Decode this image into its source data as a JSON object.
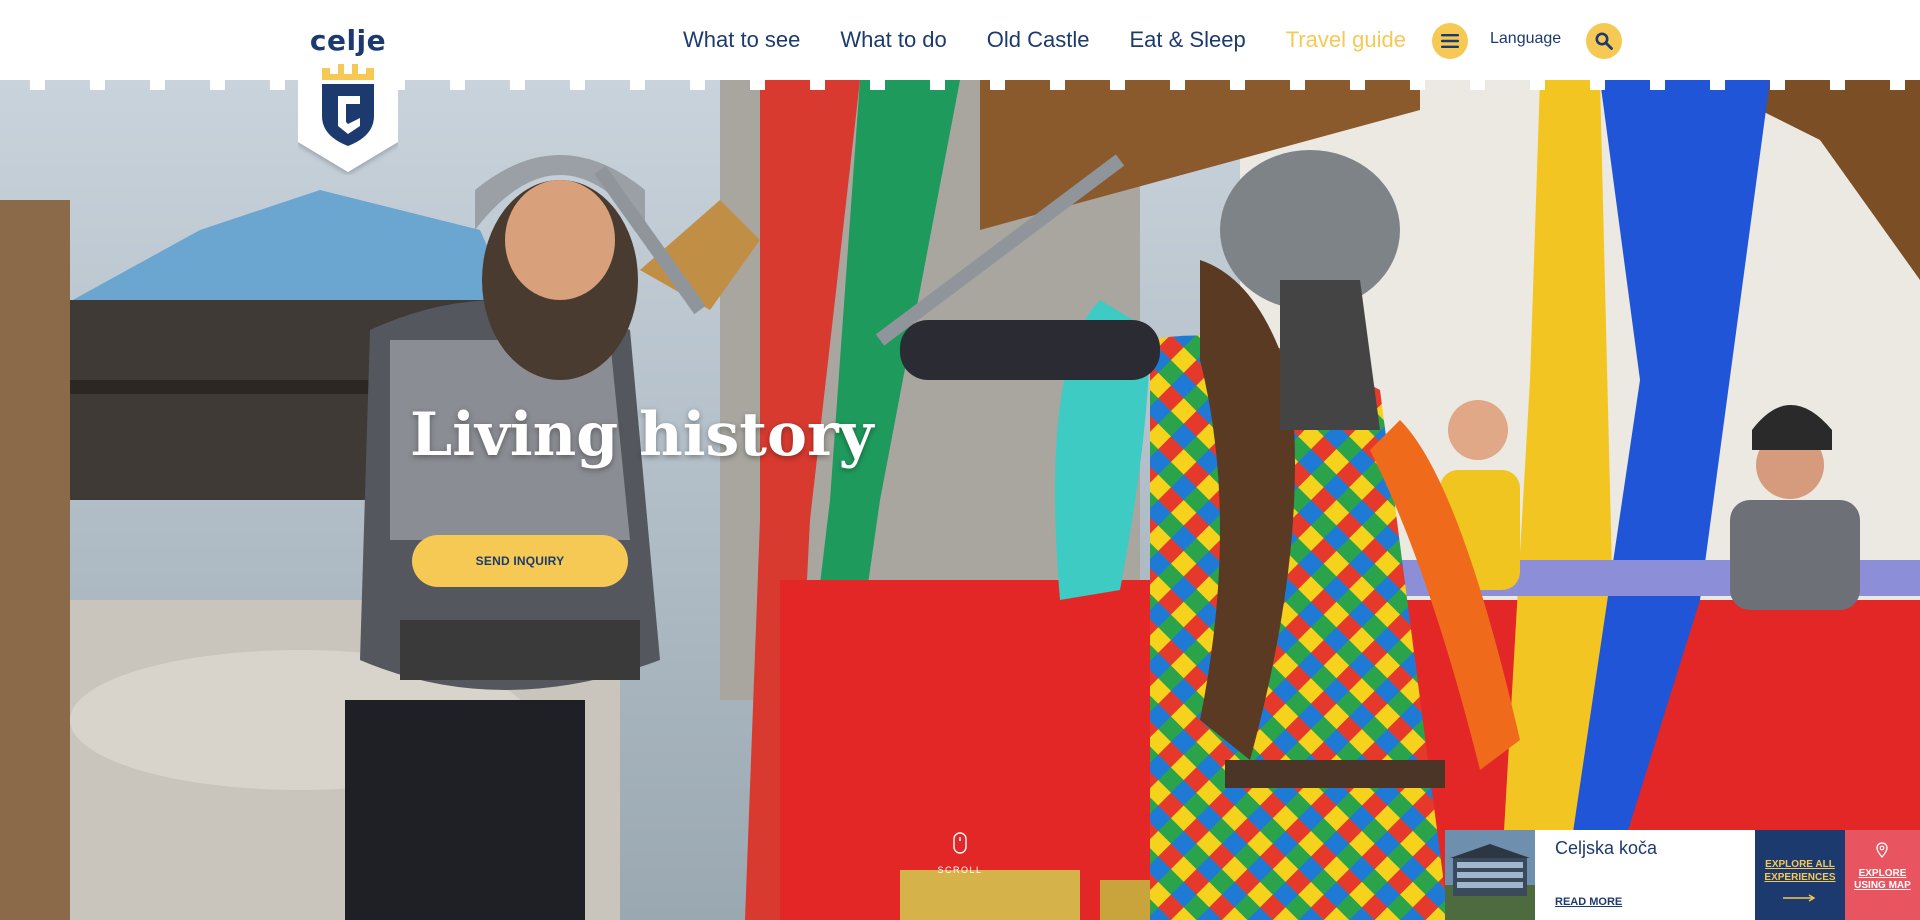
{
  "brand": {
    "logo_text": "celje",
    "colors": {
      "navy": "#1d3a6e",
      "yellow": "#f5c953",
      "coral": "#e8545f"
    }
  },
  "nav": {
    "items": [
      {
        "label": "What to see"
      },
      {
        "label": "What to do"
      },
      {
        "label": "Old Castle"
      },
      {
        "label": "Eat & Sleep"
      },
      {
        "label": "Travel guide",
        "active": true
      }
    ],
    "menu_icon": "hamburger-icon",
    "language_label": "Language",
    "search_icon": "search-icon"
  },
  "hero": {
    "title": "Living history",
    "cta_label": "SEND INQUIRY",
    "scroll_label": "SCROLL",
    "image": "knights-sword-fight-photo"
  },
  "bottom_card": {
    "title": "Celjska koča",
    "read_more": "READ MORE",
    "explore_all": "EXPLORE ALL EXPERIENCES",
    "explore_map": "EXPLORE USING MAP",
    "arrow_icon": "arrow-right-icon",
    "pin_icon": "map-pin-icon"
  }
}
